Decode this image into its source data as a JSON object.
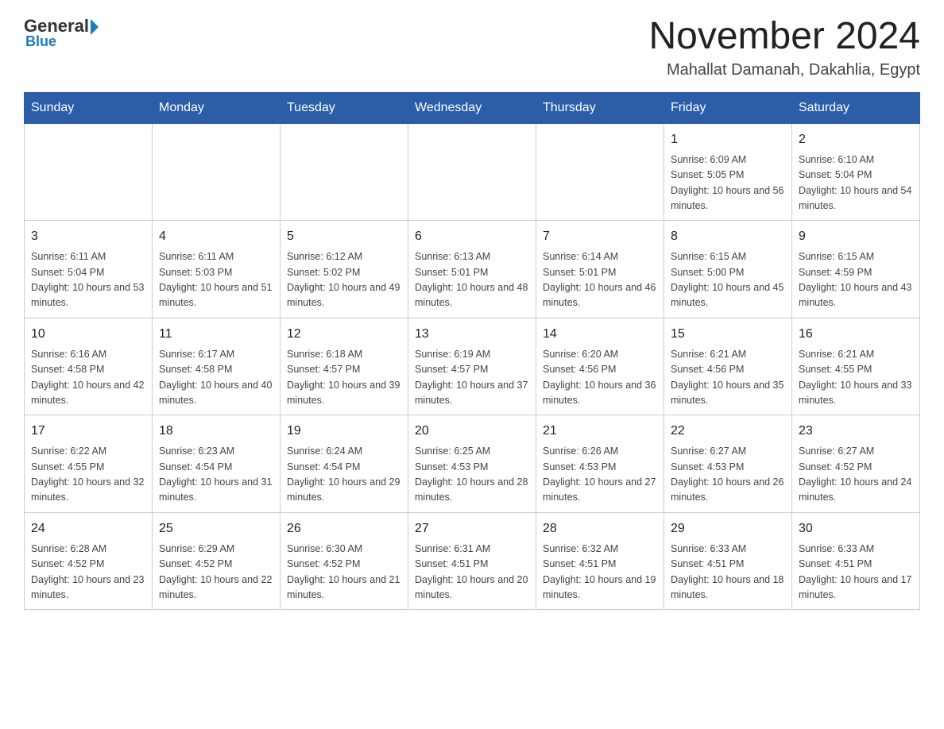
{
  "logo": {
    "general": "General",
    "triangle": "",
    "blue": "Blue"
  },
  "title": "November 2024",
  "subtitle": "Mahallat Damanah, Dakahlia, Egypt",
  "days_of_week": [
    "Sunday",
    "Monday",
    "Tuesday",
    "Wednesday",
    "Thursday",
    "Friday",
    "Saturday"
  ],
  "weeks": [
    [
      {
        "day": "",
        "info": ""
      },
      {
        "day": "",
        "info": ""
      },
      {
        "day": "",
        "info": ""
      },
      {
        "day": "",
        "info": ""
      },
      {
        "day": "",
        "info": ""
      },
      {
        "day": "1",
        "info": "Sunrise: 6:09 AM\nSunset: 5:05 PM\nDaylight: 10 hours and 56 minutes."
      },
      {
        "day": "2",
        "info": "Sunrise: 6:10 AM\nSunset: 5:04 PM\nDaylight: 10 hours and 54 minutes."
      }
    ],
    [
      {
        "day": "3",
        "info": "Sunrise: 6:11 AM\nSunset: 5:04 PM\nDaylight: 10 hours and 53 minutes."
      },
      {
        "day": "4",
        "info": "Sunrise: 6:11 AM\nSunset: 5:03 PM\nDaylight: 10 hours and 51 minutes."
      },
      {
        "day": "5",
        "info": "Sunrise: 6:12 AM\nSunset: 5:02 PM\nDaylight: 10 hours and 49 minutes."
      },
      {
        "day": "6",
        "info": "Sunrise: 6:13 AM\nSunset: 5:01 PM\nDaylight: 10 hours and 48 minutes."
      },
      {
        "day": "7",
        "info": "Sunrise: 6:14 AM\nSunset: 5:01 PM\nDaylight: 10 hours and 46 minutes."
      },
      {
        "day": "8",
        "info": "Sunrise: 6:15 AM\nSunset: 5:00 PM\nDaylight: 10 hours and 45 minutes."
      },
      {
        "day": "9",
        "info": "Sunrise: 6:15 AM\nSunset: 4:59 PM\nDaylight: 10 hours and 43 minutes."
      }
    ],
    [
      {
        "day": "10",
        "info": "Sunrise: 6:16 AM\nSunset: 4:58 PM\nDaylight: 10 hours and 42 minutes."
      },
      {
        "day": "11",
        "info": "Sunrise: 6:17 AM\nSunset: 4:58 PM\nDaylight: 10 hours and 40 minutes."
      },
      {
        "day": "12",
        "info": "Sunrise: 6:18 AM\nSunset: 4:57 PM\nDaylight: 10 hours and 39 minutes."
      },
      {
        "day": "13",
        "info": "Sunrise: 6:19 AM\nSunset: 4:57 PM\nDaylight: 10 hours and 37 minutes."
      },
      {
        "day": "14",
        "info": "Sunrise: 6:20 AM\nSunset: 4:56 PM\nDaylight: 10 hours and 36 minutes."
      },
      {
        "day": "15",
        "info": "Sunrise: 6:21 AM\nSunset: 4:56 PM\nDaylight: 10 hours and 35 minutes."
      },
      {
        "day": "16",
        "info": "Sunrise: 6:21 AM\nSunset: 4:55 PM\nDaylight: 10 hours and 33 minutes."
      }
    ],
    [
      {
        "day": "17",
        "info": "Sunrise: 6:22 AM\nSunset: 4:55 PM\nDaylight: 10 hours and 32 minutes."
      },
      {
        "day": "18",
        "info": "Sunrise: 6:23 AM\nSunset: 4:54 PM\nDaylight: 10 hours and 31 minutes."
      },
      {
        "day": "19",
        "info": "Sunrise: 6:24 AM\nSunset: 4:54 PM\nDaylight: 10 hours and 29 minutes."
      },
      {
        "day": "20",
        "info": "Sunrise: 6:25 AM\nSunset: 4:53 PM\nDaylight: 10 hours and 28 minutes."
      },
      {
        "day": "21",
        "info": "Sunrise: 6:26 AM\nSunset: 4:53 PM\nDaylight: 10 hours and 27 minutes."
      },
      {
        "day": "22",
        "info": "Sunrise: 6:27 AM\nSunset: 4:53 PM\nDaylight: 10 hours and 26 minutes."
      },
      {
        "day": "23",
        "info": "Sunrise: 6:27 AM\nSunset: 4:52 PM\nDaylight: 10 hours and 24 minutes."
      }
    ],
    [
      {
        "day": "24",
        "info": "Sunrise: 6:28 AM\nSunset: 4:52 PM\nDaylight: 10 hours and 23 minutes."
      },
      {
        "day": "25",
        "info": "Sunrise: 6:29 AM\nSunset: 4:52 PM\nDaylight: 10 hours and 22 minutes."
      },
      {
        "day": "26",
        "info": "Sunrise: 6:30 AM\nSunset: 4:52 PM\nDaylight: 10 hours and 21 minutes."
      },
      {
        "day": "27",
        "info": "Sunrise: 6:31 AM\nSunset: 4:51 PM\nDaylight: 10 hours and 20 minutes."
      },
      {
        "day": "28",
        "info": "Sunrise: 6:32 AM\nSunset: 4:51 PM\nDaylight: 10 hours and 19 minutes."
      },
      {
        "day": "29",
        "info": "Sunrise: 6:33 AM\nSunset: 4:51 PM\nDaylight: 10 hours and 18 minutes."
      },
      {
        "day": "30",
        "info": "Sunrise: 6:33 AM\nSunset: 4:51 PM\nDaylight: 10 hours and 17 minutes."
      }
    ]
  ]
}
